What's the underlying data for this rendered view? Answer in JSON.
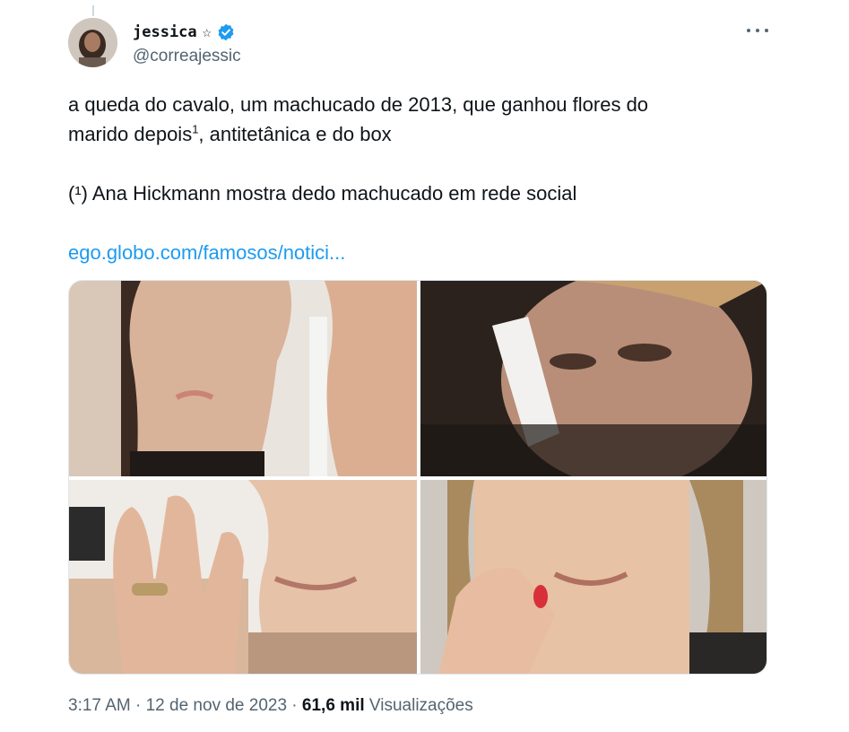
{
  "user": {
    "display_name": "jessica",
    "name_badge": "☆",
    "verified": true,
    "handle": "@correajessic",
    "avatar_icon": "avatar-photo"
  },
  "tweet": {
    "line1": "a queda do cavalo, um machucado de 2013, que ganhou flores do",
    "line2_prefix": "marido depois",
    "line2_sup": "1",
    "line2_suffix": ", antitetânica e do box",
    "footnote": "(¹) Ana Hickmann mostra dedo machucado em rede social",
    "link_text": "ego.globo.com/famosos/notici..."
  },
  "meta": {
    "time": "3:17 AM",
    "separator": " · ",
    "date": "12 de nov de 2023",
    "views_count": "61,6 mil",
    "views_label": "Visualizações"
  },
  "icons": {
    "more": "more-horizontal-icon",
    "verified": "verified-badge-icon"
  },
  "colors": {
    "link": "#1d9bf0",
    "verified": "#1d9bf0",
    "secondary_text": "#536471",
    "primary_text": "#0f1419"
  }
}
